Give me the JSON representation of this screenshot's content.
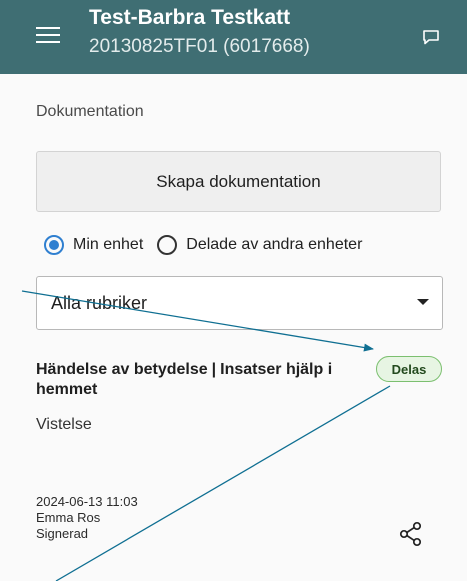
{
  "header": {
    "title": "Test-Barbra Testkatt",
    "subtitle": "20130825TF01 (6017668)",
    "background_color": "#3f6e73",
    "menu_icon": "hamburger-menu-icon",
    "chat_icon": "chat-bubble-icon"
  },
  "section_label": "Dokumentation",
  "create_button_label": "Skapa dokumentation",
  "radio": {
    "selected_color": "#2f7fd0",
    "options": [
      {
        "label": "Min enhet",
        "selected": true
      },
      {
        "label": "Delade av andra enheter",
        "selected": false
      }
    ]
  },
  "filter_select": {
    "value": "Alla rubriker",
    "caret_icon": "dropdown-caret-icon"
  },
  "entry": {
    "title_part1": "Händelse av betydelse",
    "separator": "|",
    "title_part2": "Insatser hjälp i hemmet",
    "subtitle": "Vistelse",
    "badge": "Delas",
    "badge_color": "#7bbf6f",
    "date": "2024-06-13 11:03",
    "author": "Emma Ros",
    "status": "Signerad",
    "share_icon": "share-icon"
  },
  "annotation_line_color": "#0f6f92"
}
